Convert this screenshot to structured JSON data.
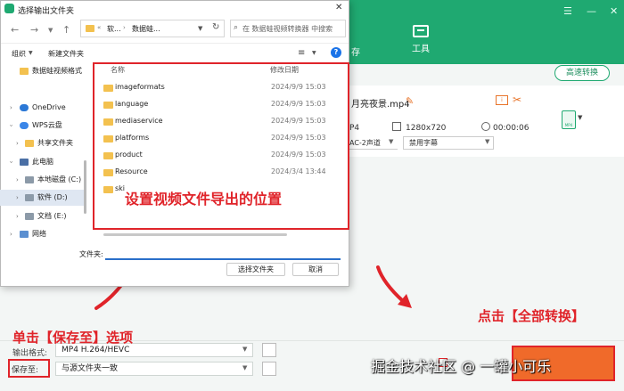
{
  "colors": {
    "brand_green": "#1fa971",
    "annotation_red": "#e0242a",
    "folder_yellow": "#f3c14f",
    "convert_orange": "#f06a2a",
    "accent_blue": "#2a6fc9"
  },
  "dialog": {
    "title": "选择输出文件夹",
    "address": {
      "crumbs": [
        "软...",
        "数据蛙..."
      ]
    },
    "search_placeholder": "在 数据蛙视频转换器 中搜索",
    "toolbar": {
      "organize": "组织",
      "new_folder": "新建文件夹"
    },
    "nav": [
      {
        "label": "数据蛙视频格式",
        "icon": "folder-icon"
      },
      {
        "label": "OneDrive",
        "icon": "cloud-icon"
      },
      {
        "label": "WPS云盘",
        "icon": "cloud-icon"
      },
      {
        "label": "共享文件夹",
        "icon": "folder-icon"
      },
      {
        "label": "此电脑",
        "icon": "computer-icon"
      },
      {
        "label": "本地磁盘 (C:)",
        "icon": "drive-icon"
      },
      {
        "label": "软件 (D:)",
        "icon": "drive-icon"
      },
      {
        "label": "文档 (E:)",
        "icon": "drive-icon"
      },
      {
        "label": "网络",
        "icon": "network-icon"
      }
    ],
    "columns": {
      "name": "名称",
      "date": "修改日期"
    },
    "files": [
      {
        "name": "imageformats",
        "date": "2024/9/9 15:03"
      },
      {
        "name": "language",
        "date": "2024/9/9 15:03"
      },
      {
        "name": "mediaservice",
        "date": "2024/9/9 15:03"
      },
      {
        "name": "platforms",
        "date": "2024/9/9 15:03"
      },
      {
        "name": "product",
        "date": "2024/9/9 15:03"
      },
      {
        "name": "Resource",
        "date": "2024/3/4 13:44"
      },
      {
        "name": "ski",
        "date": ""
      }
    ],
    "folder_label": "文件夹:",
    "folder_value": "",
    "select_button": "选择文件夹",
    "cancel_button": "取消"
  },
  "app": {
    "tab_left_fragment": "存",
    "tool_tab": "工具",
    "fast_convert": "高速转换",
    "file_title": "月亮夜景.mp4",
    "format_fragment": "P4",
    "resolution": "1280x720",
    "duration": "00:00:06",
    "audio_fragment": "AC-2声道",
    "subtitle": "禁用字幕",
    "output_format_label": "输出格式:",
    "output_format_value": "MP4 H.264/HEVC",
    "save_label": "保存至:",
    "save_value": "与源文件夹一致"
  },
  "annotations": {
    "save_hint": "单击【保存至】选项",
    "convert_hint": "点击【全部转换】",
    "location_hint": "设置视频文件导出的位置",
    "watermark": "掘金技术社区 @ 一罐小可乐"
  }
}
